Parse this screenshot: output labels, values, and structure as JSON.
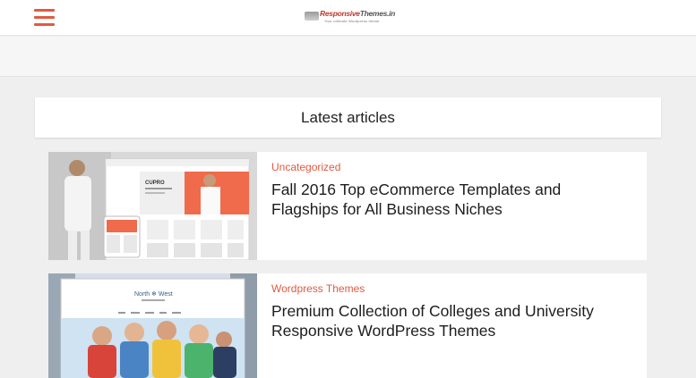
{
  "header": {
    "logo_text_a": "Responsive",
    "logo_text_b": "Themes.in",
    "logo_tagline": "Your ultimate Wordpress theme"
  },
  "section": {
    "title": "Latest articles"
  },
  "articles": [
    {
      "category": "Uncategorized",
      "title": "Fall 2016 Top eCommerce Templates and Flagships for All Business Niches",
      "thumb_brand": "CUPRO"
    },
    {
      "category": "Wordpress Themes",
      "title": "Premium Collection of Colleges and University Responsive WordPress Themes",
      "thumb_brand": "North ❄ West"
    }
  ],
  "colors": {
    "accent": "#e05a41",
    "background": "#efefef"
  },
  "icons": {
    "menu": "hamburger-icon"
  }
}
